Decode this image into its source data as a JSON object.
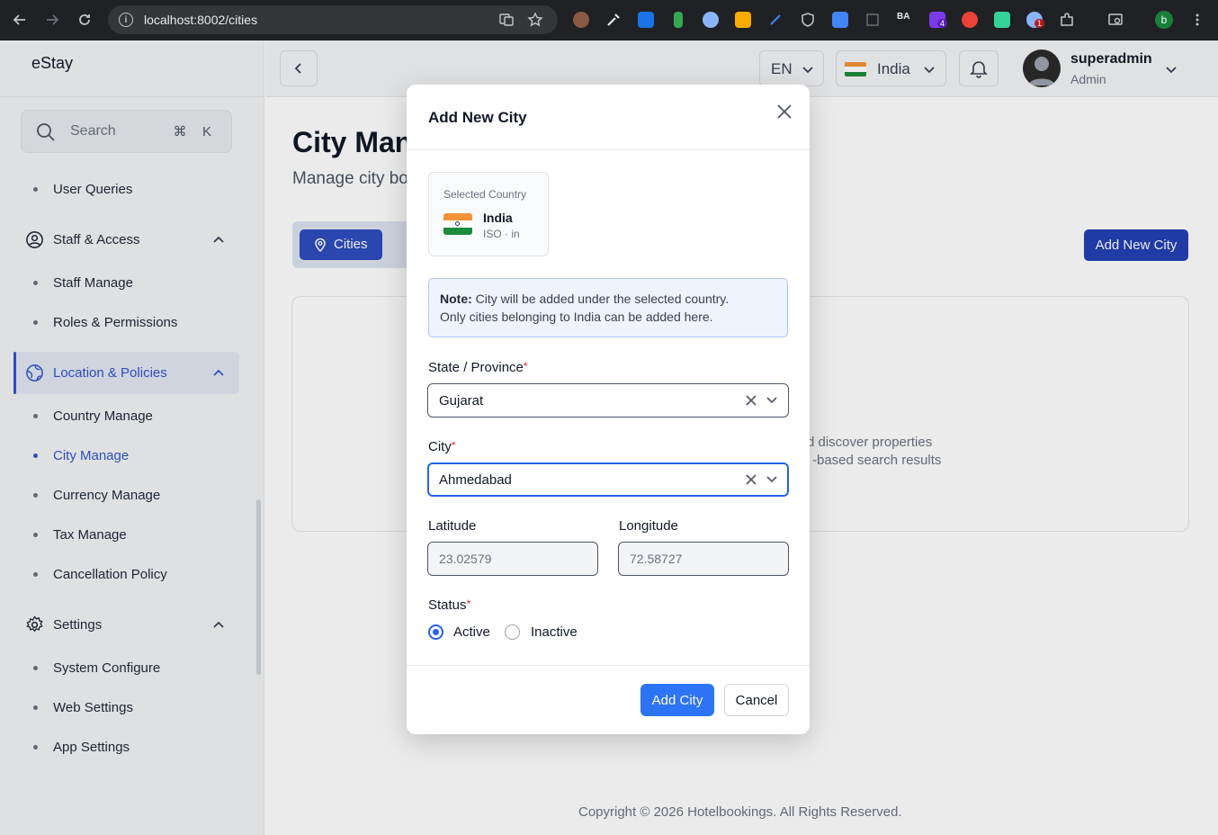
{
  "browser": {
    "url": "localhost:8002/cities",
    "profile_initial": "b",
    "ext_badge_1": "4",
    "ext_badge_2": "1"
  },
  "sidebar": {
    "brand": "eStay",
    "search_placeholder": "Search",
    "kbd_cmd": "⌘",
    "kbd_k": "K",
    "items": {
      "user_queries": "User Queries",
      "staff_access": "Staff & Access",
      "staff_manage": "Staff Manage",
      "roles_permissions": "Roles & Permissions",
      "location_policies": "Location & Policies",
      "country_manage": "Country Manage",
      "city_manage": "City Manage",
      "currency_manage": "Currency Manage",
      "tax_manage": "Tax Manage",
      "cancellation_policy": "Cancellation Policy",
      "settings": "Settings",
      "system_configure": "System Configure",
      "web_settings": "Web Settings",
      "app_settings": "App Settings"
    }
  },
  "header": {
    "language": "EN",
    "country": "India",
    "user_name": "superadmin",
    "user_role": "Admin"
  },
  "main": {
    "title": "City Man",
    "subtitle": "Manage city bo",
    "tab_cities": "Cities",
    "add_new_city": "Add New City",
    "empty_line1": "d discover properties",
    "empty_line2": "-based search results",
    "footer": "Copyright © 2026 Hotelbookings. All Rights Reserved."
  },
  "modal": {
    "title": "Add New City",
    "selected_country_label": "Selected Country",
    "country_name": "India",
    "country_iso": "ISO · in",
    "note_bold": "Note:",
    "note_line1": " City will be added under the selected country.",
    "note_line2": "Only cities belonging to India can be added here.",
    "state_label": "State / Province",
    "state_value": "Gujarat",
    "city_label": "City",
    "city_value": "Ahmedabad",
    "latitude_label": "Latitude",
    "latitude_value": "23.02579",
    "longitude_label": "Longitude",
    "longitude_value": "72.58727",
    "status_label": "Status",
    "status_active": "Active",
    "status_inactive": "Inactive",
    "add_button": "Add City",
    "cancel_button": "Cancel",
    "required_mark": "*"
  },
  "colors": {
    "primary": "#2563eb",
    "sidebar_active": "#3355cc",
    "required": "#dc2626"
  }
}
